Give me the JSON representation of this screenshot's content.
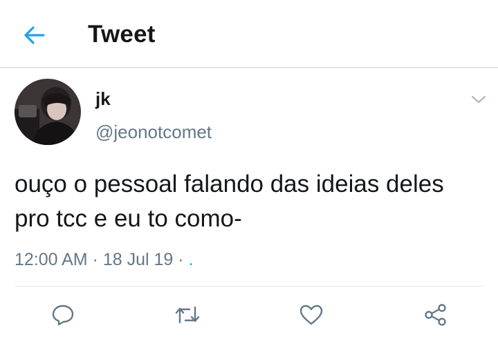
{
  "header": {
    "back_icon": "arrow-left-icon",
    "title": "Tweet",
    "accent_color": "#1da1f2"
  },
  "tweet": {
    "avatar": "profile-photo",
    "display_name": "jk",
    "handle": "@jeonotcomet",
    "menu_icon": "chevron-down-icon",
    "text": "ouço o pessoal falando das ideias deles pro tcc e eu to como-",
    "time": "12:00 AM",
    "date": "18 Jul 19",
    "separator": "·",
    "source": "."
  },
  "actions": {
    "reply_icon": "reply-icon",
    "retweet_icon": "retweet-icon",
    "like_icon": "heart-icon",
    "share_icon": "share-icon"
  },
  "colors": {
    "text_primary": "#14171a",
    "text_secondary": "#657786",
    "divider": "#e1e8ed"
  }
}
